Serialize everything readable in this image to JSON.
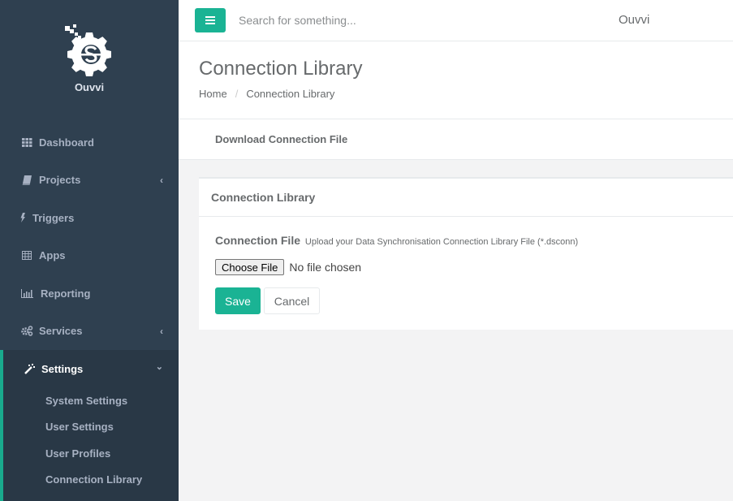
{
  "brand": {
    "name": "Ouvvi",
    "logo_icon": "gear-s-logo-icon"
  },
  "sidebar": {
    "items": [
      {
        "label": "Dashboard",
        "icon": "th-grid-icon",
        "has_arrow": false
      },
      {
        "label": "Projects",
        "icon": "book-icon",
        "has_arrow": true
      },
      {
        "label": "Triggers",
        "icon": "bolt-icon",
        "has_arrow": false
      },
      {
        "label": "Apps",
        "icon": "table-icon",
        "has_arrow": false
      },
      {
        "label": "Reporting",
        "icon": "bar-chart-icon",
        "has_arrow": false
      },
      {
        "label": "Services",
        "icon": "cogs-icon",
        "has_arrow": true
      }
    ],
    "active_group": {
      "label": "Settings",
      "icon": "magic-wand-icon",
      "children": [
        {
          "label": "System Settings"
        },
        {
          "label": "User Settings"
        },
        {
          "label": "User Profiles"
        },
        {
          "label": "Connection Library"
        }
      ]
    },
    "arrow_collapsed": "‹",
    "arrow_expanded": "⌄"
  },
  "topbar": {
    "menu_icon": "hamburger-icon",
    "search_placeholder": "Search for something...",
    "search_value": "",
    "user_label": "Ouvvi"
  },
  "heading": {
    "title": "Connection Library",
    "breadcrumb": [
      {
        "label": "Home"
      },
      {
        "label": "Connection Library"
      }
    ],
    "breadcrumb_separator": "/"
  },
  "actions": {
    "download_label": "Download Connection File"
  },
  "panel": {
    "title": "Connection Library",
    "field_label": "Connection File",
    "field_hint": "Upload your Data Synchronisation Connection Library File (*.dsconn)",
    "choose_file_label": "Choose File",
    "file_status": "No file chosen",
    "save_label": "Save",
    "cancel_label": "Cancel"
  },
  "colors": {
    "accent": "#1ab394",
    "sidebar_bg": "#2f4050",
    "sidebar_active_bg": "#293846",
    "page_bg": "#f3f3f4",
    "text": "#676a6c"
  }
}
